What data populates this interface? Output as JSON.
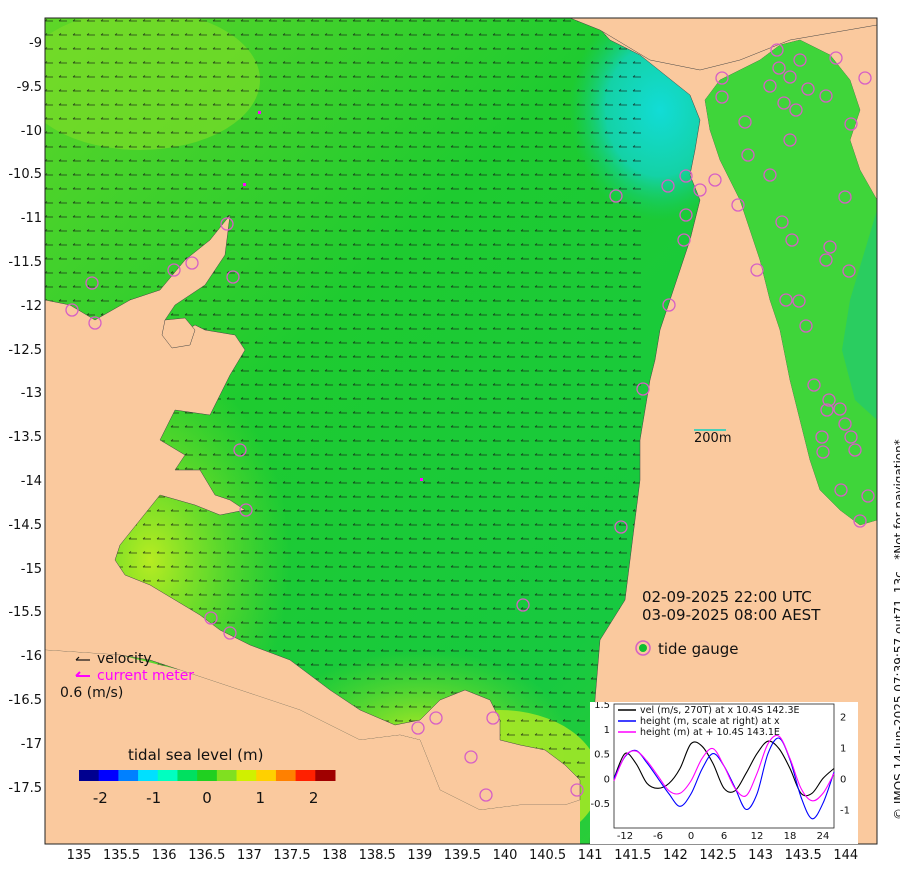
{
  "map": {
    "lat_ticks": [
      "-9",
      "-9.5",
      "-10",
      "-10.5",
      "-11",
      "-11.5",
      "-12",
      "-12.5",
      "-13",
      "-13.5",
      "-14",
      "-14.5",
      "-15",
      "-15.5",
      "-16",
      "-16.5",
      "-17",
      "-17.5"
    ],
    "lon_ticks": [
      "135",
      "135.5",
      "136",
      "136.5",
      "137",
      "137.5",
      "138",
      "138.5",
      "139",
      "139.5",
      "140",
      "140.5",
      "141",
      "141.5",
      "142",
      "142.5",
      "143",
      "143.5",
      "144"
    ],
    "scale_label": "200m",
    "time_utc": "02-09-2025 22:00 UTC",
    "time_aest": "03-09-2025 08:00 AEST",
    "tide_gauge_label": "tide gauge",
    "legend": {
      "velocity_label": "velocity",
      "current_meter_label": "current meter",
      "speed_scale": "0.6 (m/s)"
    },
    "colorbar": {
      "title": "tidal sea level (m)",
      "tick_labels": [
        "-2",
        "-1",
        "0",
        "1",
        "2"
      ],
      "range": [
        -2.4,
        2.4
      ],
      "colors": [
        "#00008f",
        "#0000ff",
        "#0080ff",
        "#00e0ff",
        "#00ffc0",
        "#00e060",
        "#20d020",
        "#80e020",
        "#d0f000",
        "#ffd000",
        "#ff8000",
        "#ff2000",
        "#a00000"
      ]
    },
    "copyright": "© IMOS 14-Jun-2025 07:39:57 out71_13c . *Not for navigation*",
    "colors": {
      "land": "#fac99e",
      "sea_main": "#12c93a",
      "sea_shallow": "#7ee027",
      "cyan_region": "#13d8c5",
      "gauge_ring": "#d65fc5",
      "current_meter": "#ff00ff"
    }
  },
  "inset": {
    "legend": [
      {
        "label": "vel (m/s, 270T) at x 10.4S 142.3E",
        "color": "#000000"
      },
      {
        "label": "height (m, scale at right) at x",
        "color": "#0000ff"
      },
      {
        "label": "height (m) at + 10.4S 143.1E",
        "color": "#ff00ff"
      }
    ],
    "left_ticks": [
      "1.5",
      "1",
      "0.5",
      "0",
      "-0.5"
    ],
    "right_ticks": [
      "2",
      "1",
      "0",
      "-1"
    ],
    "x_ticks": [
      "-12",
      "-6",
      "0",
      "6",
      "12",
      "18",
      "24"
    ]
  },
  "chart_data": {
    "type": "line",
    "x_range": [
      -14,
      26
    ],
    "y_range_left": [
      -1.0,
      1.5
    ],
    "y_range_right": [
      -1.6,
      2.4
    ],
    "series": [
      {
        "name": "vel (m/s, 270T) at x 10.4S 142.3E",
        "axis": "left",
        "x": [
          -14,
          -12,
          -10,
          -8,
          -6,
          -4,
          -2,
          0,
          2,
          4,
          6,
          8,
          10,
          12,
          14,
          16,
          18,
          20,
          22,
          24,
          26
        ],
        "y": [
          0.0,
          0.5,
          0.3,
          -0.1,
          -0.2,
          -0.1,
          0.2,
          0.7,
          0.65,
          0.3,
          -0.2,
          -0.25,
          0.1,
          0.5,
          0.75,
          0.6,
          0.2,
          -0.3,
          -0.3,
          0.0,
          0.2
        ]
      },
      {
        "name": "height (m, scale at right) at x",
        "axis": "right",
        "x": [
          -14,
          -12,
          -10,
          -8,
          -6,
          -4,
          -2,
          0,
          2,
          4,
          6,
          8,
          10,
          12,
          14,
          16,
          18,
          20,
          22,
          24,
          26
        ],
        "y": [
          0.0,
          0.7,
          0.9,
          0.5,
          0.0,
          -0.5,
          -0.9,
          -0.5,
          0.3,
          0.8,
          0.4,
          -0.3,
          -1.0,
          -0.5,
          0.8,
          1.3,
          0.6,
          -0.6,
          -1.3,
          -0.8,
          0.2
        ]
      },
      {
        "name": "height (m) at + 10.4S 143.1E",
        "axis": "left",
        "x": [
          -14,
          -12,
          -10,
          -8,
          -6,
          -4,
          -2,
          0,
          2,
          4,
          6,
          8,
          10,
          12,
          14,
          16,
          18,
          20,
          22,
          24,
          26
        ],
        "y": [
          -0.05,
          0.45,
          0.55,
          0.35,
          0.05,
          -0.25,
          -0.3,
          -0.05,
          0.4,
          0.6,
          0.25,
          -0.2,
          -0.35,
          0.1,
          0.7,
          0.85,
          0.4,
          -0.2,
          -0.45,
          -0.3,
          0.1
        ]
      }
    ]
  }
}
